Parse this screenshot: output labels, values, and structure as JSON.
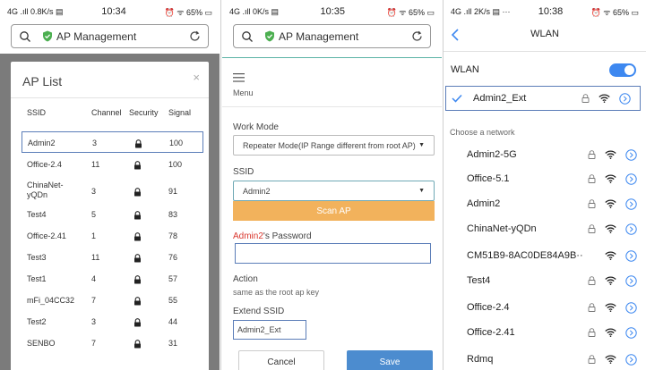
{
  "panel1": {
    "status": {
      "left": "4G .ıll 0.8K/s ▤",
      "time": "10:34",
      "right": "⏰ ᯤ 65% ▭"
    },
    "address": {
      "text": "AP Management"
    },
    "modal": {
      "title": "AP List",
      "close": "×",
      "columns": {
        "ssid": "SSID",
        "channel": "Channel",
        "security": "Security",
        "signal": "Signal"
      },
      "rows": [
        {
          "ssid": "Admin2",
          "channel": "3",
          "signal": "100"
        },
        {
          "ssid": "Office-2.4",
          "channel": "11",
          "signal": "100"
        },
        {
          "ssid": "ChinaNet-\nyQDn",
          "channel": "3",
          "signal": "91"
        },
        {
          "ssid": "Test4",
          "channel": "5",
          "signal": "83"
        },
        {
          "ssid": "Office-2.41",
          "channel": "1",
          "signal": "78"
        },
        {
          "ssid": "Test3",
          "channel": "11",
          "signal": "76"
        },
        {
          "ssid": "Test1",
          "channel": "4",
          "signal": "57"
        },
        {
          "ssid": "mFi_04CC32",
          "channel": "7",
          "signal": "55"
        },
        {
          "ssid": "Test2",
          "channel": "3",
          "signal": "44"
        },
        {
          "ssid": "SENBO",
          "channel": "7",
          "signal": "31"
        }
      ]
    }
  },
  "panel2": {
    "status": {
      "left": "4G .ıll 0K/s ▤",
      "time": "10:35",
      "right": "⏰ ᯤ 65% ▭"
    },
    "address": {
      "text": "AP Management"
    },
    "menu_label": "Menu",
    "work_mode_label": "Work Mode",
    "work_mode_value": "Repeater Mode(IP Range different from root AP)",
    "ssid_label": "SSID",
    "ssid_value": "Admin2",
    "scan_label": "Scan AP",
    "password_ssid": "Admin2",
    "password_suffix": "'s Password",
    "action_label": "Action",
    "action_value": "same as the root ap key",
    "extend_label": "Extend SSID",
    "extend_value": "Admin2_Ext",
    "cancel_label": "Cancel",
    "save_label": "Save"
  },
  "panel3": {
    "status": {
      "left": "4G .ıll 2K/s ▤ ···",
      "time": "10:38",
      "right": "⏰ ᯤ 65% ▭"
    },
    "title": "WLAN",
    "wlan_label": "WLAN",
    "toggle_on": true,
    "connected": "Admin2_Ext",
    "choose_label": "Choose a network",
    "networks": [
      {
        "name": "Admin2-5G"
      },
      {
        "name": "Office-5.1"
      },
      {
        "name": "Admin2"
      },
      {
        "name": "ChinaNet-yQDn"
      },
      {
        "name": "CM51B9-8AC0DE84A9B··"
      },
      {
        "name": "Test4"
      },
      {
        "name": "Office-2.4"
      },
      {
        "name": "Office-2.41"
      },
      {
        "name": "Rdmq"
      }
    ]
  },
  "colors": {
    "accent_blue": "#3d88f0",
    "scan_orange": "#f2b25c",
    "save_blue": "#4c8ccf",
    "shield_green": "#4caf50",
    "password_red": "#d9372e"
  }
}
